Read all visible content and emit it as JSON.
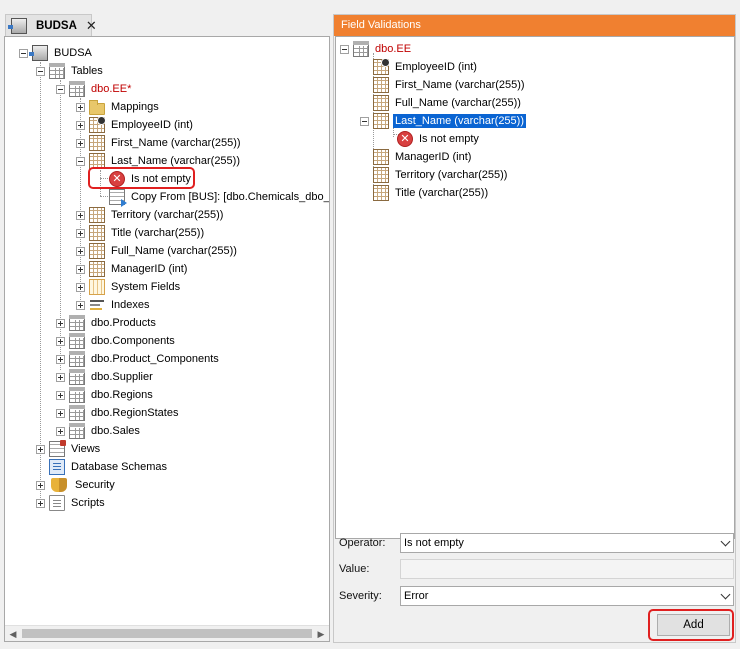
{
  "tab": {
    "title": "BUDSA"
  },
  "left_tree": {
    "root": "BUDSA",
    "tables": "Tables",
    "dbo_ee": "dbo.EE*",
    "mappings": "Mappings",
    "employee_id": "EmployeeID (int)",
    "first_name": "First_Name (varchar(255))",
    "last_name": "Last_Name (varchar(255))",
    "is_not_empty": "Is not empty",
    "copy_from": "Copy From [BUS]: [dbo.Chemicals_dbo_E",
    "territory": "Territory (varchar(255))",
    "title": "Title (varchar(255))",
    "full_name": "Full_Name (varchar(255))",
    "manager_id": "ManagerID (int)",
    "system_fields": "System Fields",
    "indexes": "Indexes",
    "products": "dbo.Products",
    "components": "dbo.Components",
    "product_components": "dbo.Product_Components",
    "supplier": "dbo.Supplier",
    "regions": "dbo.Regions",
    "region_states": "dbo.RegionStates",
    "sales": "dbo.Sales",
    "views": "Views",
    "database_schemas": "Database Schemas",
    "security": "Security",
    "scripts": "Scripts"
  },
  "right_panel": {
    "header": "Field Validations",
    "tree": {
      "dbo_ee": "dbo.EE",
      "employee_id": "EmployeeID (int)",
      "first_name": "First_Name (varchar(255))",
      "full_name": "Full_Name (varchar(255))",
      "last_name": "Last_Name (varchar(255))",
      "is_not_empty": "Is not empty",
      "manager_id": "ManagerID (int)",
      "territory": "Territory (varchar(255))",
      "title": "Title (varchar(255))"
    },
    "form": {
      "operator_label": "Operator:",
      "operator_value": "Is not empty",
      "value_label": "Value:",
      "value_value": "",
      "severity_label": "Severity:",
      "severity_value": "Error",
      "add_label": "Add"
    }
  },
  "icons": {
    "close": "close-icon",
    "error": "error-icon"
  },
  "colors": {
    "header_orange": "#f08030",
    "selection_blue": "#0a64d2",
    "table_red_label": "#c00000",
    "highlight_red": "#e02020"
  }
}
